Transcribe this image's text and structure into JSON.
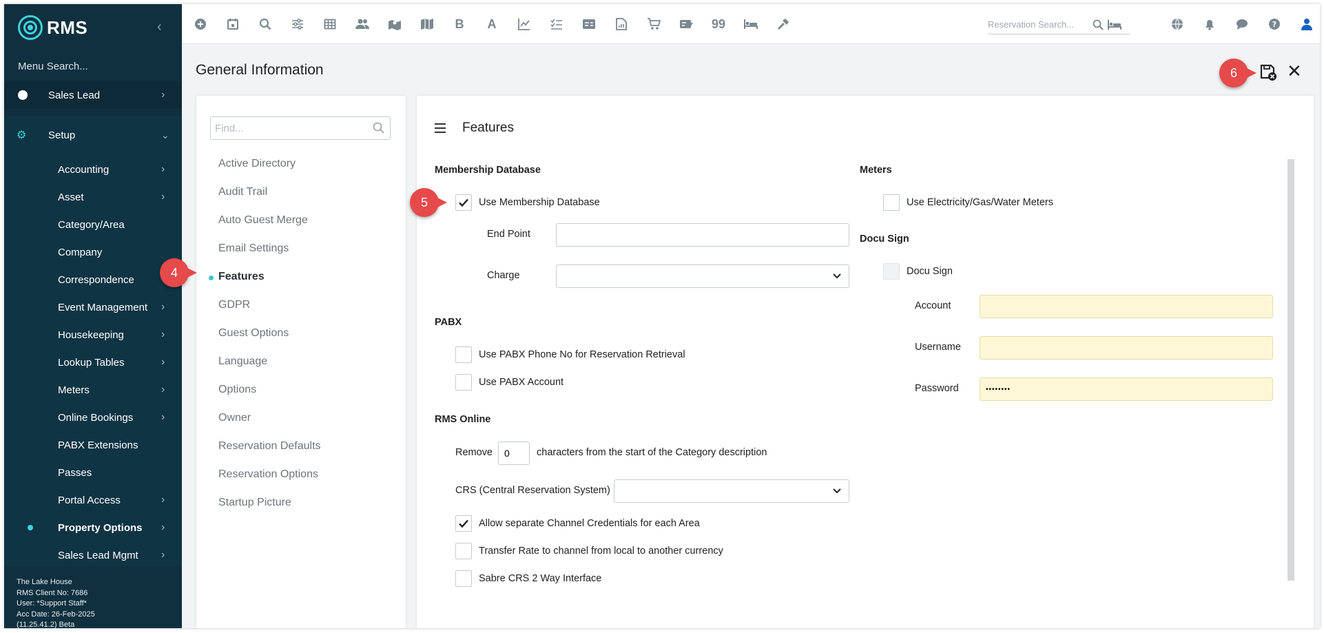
{
  "app": {
    "logo_text": "RMS"
  },
  "sidebar": {
    "menu_search": "Menu Search...",
    "top_items": [
      {
        "label": "Sales Lead"
      }
    ],
    "setup": {
      "label": "Setup"
    },
    "setup_items": [
      {
        "label": "Accounting"
      },
      {
        "label": "Asset"
      },
      {
        "label": "Category/Area"
      },
      {
        "label": "Company"
      },
      {
        "label": "Correspondence"
      },
      {
        "label": "Event Management"
      },
      {
        "label": "Housekeeping"
      },
      {
        "label": "Lookup Tables"
      },
      {
        "label": "Meters"
      },
      {
        "label": "Online Bookings"
      },
      {
        "label": "PABX Extensions"
      },
      {
        "label": "Passes"
      },
      {
        "label": "Portal Access"
      },
      {
        "label": "Property Options"
      },
      {
        "label": "Sales Lead Mgmt"
      }
    ],
    "footer": {
      "property": "The Lake House",
      "client_no": "RMS Client No: 7686",
      "user": "User: *Support Staff*",
      "acc_date": "Acc Date: 26-Feb-2025",
      "version": "(11.25.41.2) Beta"
    }
  },
  "toolbar": {
    "letter_b": "B",
    "letter_a": "A",
    "quote_glyph": "99",
    "search_placeholder": "Reservation Search..."
  },
  "header": {
    "title": "General Information"
  },
  "left_panel": {
    "find_placeholder": "Find...",
    "sections": [
      {
        "label": "Active Directory"
      },
      {
        "label": "Audit Trail"
      },
      {
        "label": "Auto Guest Merge"
      },
      {
        "label": "Email Settings"
      },
      {
        "label": "Features"
      },
      {
        "label": "GDPR"
      },
      {
        "label": "Guest Options"
      },
      {
        "label": "Language"
      },
      {
        "label": "Options"
      },
      {
        "label": "Owner"
      },
      {
        "label": "Reservation Defaults"
      },
      {
        "label": "Reservation Options"
      },
      {
        "label": "Startup Picture"
      }
    ]
  },
  "features": {
    "title": "Features",
    "membership": {
      "heading": "Membership Database",
      "use_label": "Use Membership Database",
      "end_point_label": "End Point",
      "end_point_value": "",
      "charge_label": "Charge",
      "charge_value": ""
    },
    "pabx": {
      "heading": "PABX",
      "phone_label": "Use PABX Phone No for Reservation Retrieval",
      "account_label": "Use PABX Account"
    },
    "rms_online": {
      "heading": "RMS Online",
      "remove_label": "Remove",
      "remove_value": "0",
      "remove_suffix": "characters from the start of the Category description",
      "crs_label": "CRS (Central Reservation System)",
      "crs_value": "",
      "allow_label": "Allow separate Channel Credentials for each Area",
      "transfer_label": "Transfer Rate to channel from local to another currency",
      "sabre_label": "Sabre CRS 2 Way Interface"
    },
    "meters": {
      "heading": "Meters",
      "use_label": "Use Electricity/Gas/Water Meters"
    },
    "docusign": {
      "heading": "Docu Sign",
      "check_label": "Docu Sign",
      "account_label": "Account",
      "account_value": "",
      "username_label": "Username",
      "username_value": "",
      "password_label": "Password",
      "password_value": "••••••••"
    }
  },
  "callouts": {
    "c4": "4",
    "c5": "5",
    "c6": "6"
  },
  "colors": {
    "sidebar_bg": "#10303f",
    "accent": "#3ed3dc",
    "callout": "#e64a4a",
    "docusign_field": "#fdf7d5"
  }
}
